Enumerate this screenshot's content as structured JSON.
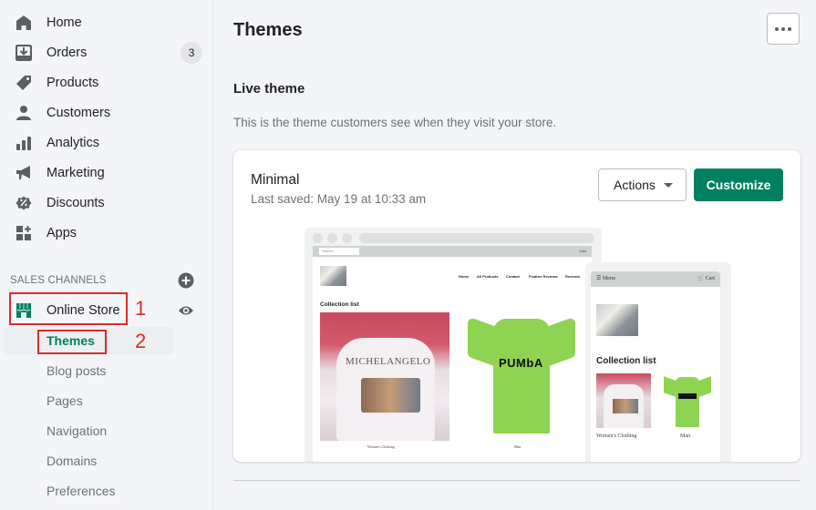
{
  "sidebar": {
    "items": [
      {
        "label": "Home",
        "icon": "home-icon"
      },
      {
        "label": "Orders",
        "icon": "orders-icon",
        "badge": "3"
      },
      {
        "label": "Products",
        "icon": "tag-icon"
      },
      {
        "label": "Customers",
        "icon": "person-icon"
      },
      {
        "label": "Analytics",
        "icon": "bar-chart-icon"
      },
      {
        "label": "Marketing",
        "icon": "megaphone-icon"
      },
      {
        "label": "Discounts",
        "icon": "discount-icon"
      },
      {
        "label": "Apps",
        "icon": "apps-icon"
      }
    ],
    "sales_channels_label": "SALES CHANNELS",
    "online_store": {
      "label": "Online Store",
      "icon": "store-icon"
    },
    "sub_items": [
      {
        "label": "Themes",
        "active": true
      },
      {
        "label": "Blog posts"
      },
      {
        "label": "Pages"
      },
      {
        "label": "Navigation"
      },
      {
        "label": "Domains"
      },
      {
        "label": "Preferences"
      }
    ],
    "annotations": [
      "1",
      "2"
    ]
  },
  "page": {
    "title": "Themes",
    "more_actions_icon": "ellipsis-icon",
    "live_theme": {
      "heading": "Live theme",
      "description": "This is the theme customers see when they visit your store.",
      "theme_name": "Minimal",
      "last_saved": "Last saved: May 19 at 10:33 am",
      "actions_label": "Actions",
      "customize_label": "Customize"
    }
  },
  "preview": {
    "desktop": {
      "search_placeholder": "Search",
      "cart": "Cart",
      "nav": [
        "Home",
        "All Products",
        "Contact",
        "Feature Reviews",
        "Reviews"
      ],
      "collection_heading": "Collection list",
      "shirt_text": "MICHELANGELO",
      "tee_text": "PUMbA",
      "captions": [
        "Women's Clothing",
        "Man"
      ]
    },
    "mobile": {
      "menu": "Menu",
      "cart": "Cart",
      "collection_heading": "Collection list",
      "captions": [
        "Women's Clothing",
        "Man"
      ]
    }
  },
  "colors": {
    "brand_green": "#008060",
    "annotation_red": "#d82c2c",
    "page_bg": "#f4f5f8"
  }
}
